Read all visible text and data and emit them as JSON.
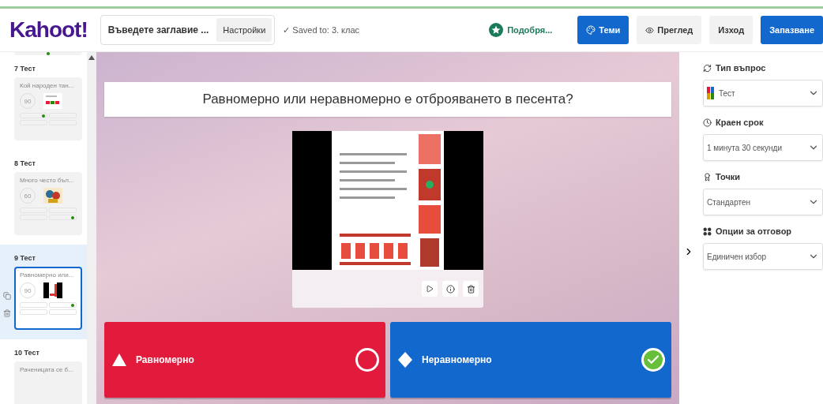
{
  "header": {
    "logo": "Kahoot!",
    "title_field": "Въведете заглавие ...",
    "settings_button": "Настройки",
    "saved_mark": "✓",
    "saved_status": "Saved to: 3. клас",
    "upgrade": "Подобря...",
    "buttons": [
      {
        "label": "Теми",
        "kind": "primary"
      },
      {
        "label": "Преглед",
        "kind": "secondary"
      },
      {
        "label": "Изход",
        "kind": "secondary"
      },
      {
        "label": "Запазване",
        "kind": "primary"
      }
    ]
  },
  "slides": [
    {
      "number": "7",
      "type": "Тест",
      "title": "Кой народен тан...",
      "time": "90",
      "selected": false
    },
    {
      "number": "8",
      "type": "Тест",
      "title": "Много често бъл...",
      "time": "60",
      "selected": false
    },
    {
      "number": "9",
      "type": "Тест",
      "title": "Равномерно или...",
      "time": "90",
      "selected": true
    },
    {
      "number": "10",
      "type": "Тест",
      "title": "Раченицата се б...",
      "selected": false
    }
  ],
  "question": "Равномерно или неравномерно е отброяването в песента?",
  "answers": [
    {
      "kind": "triangle",
      "text": "Равномерно",
      "correct": false,
      "color": "#e21b3c"
    },
    {
      "kind": "diamond",
      "text": "Неравномерно",
      "correct": true,
      "color": "#1368ce"
    }
  ],
  "settings": [
    {
      "label": "Тип въпрос",
      "value": "Тест"
    },
    {
      "label": "Краен срок",
      "value": "1 минута 30 секунди"
    },
    {
      "label": "Точки",
      "value": "Стандартен"
    },
    {
      "label": "Опции за отговор",
      "value": "Единичен избор"
    }
  ]
}
